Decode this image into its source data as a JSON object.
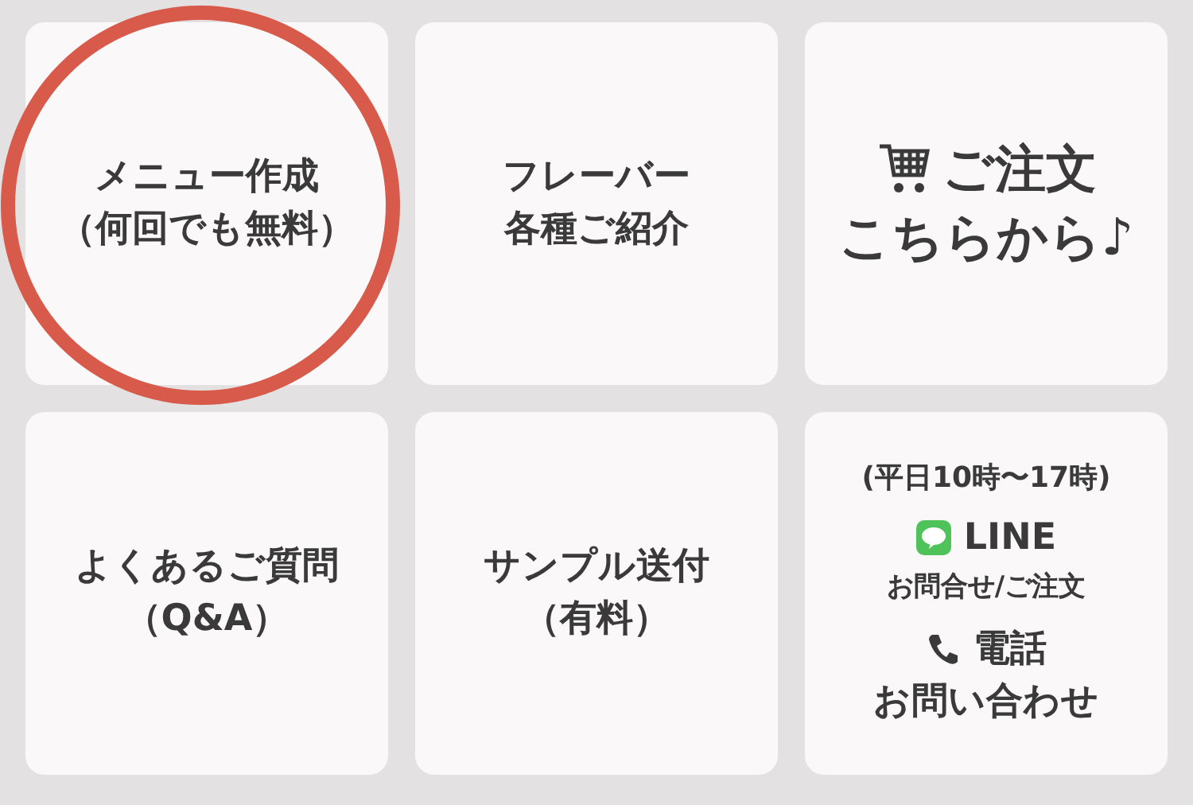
{
  "tiles": [
    {
      "kind": "link",
      "circled": true,
      "lines": [
        "メニュー作成",
        "（何回でも無料）"
      ]
    },
    {
      "kind": "link",
      "circled": false,
      "lines": [
        "フレーバー",
        "各種ご紹介"
      ]
    },
    {
      "kind": "order",
      "circled": false,
      "lines": [
        "ご注文",
        "こちらから♪"
      ]
    },
    {
      "kind": "link",
      "circled": false,
      "lines": [
        "よくあるご質問",
        "（Q&A）"
      ]
    },
    {
      "kind": "link",
      "circled": false,
      "lines": [
        "サンプル送付",
        "（有料）"
      ]
    },
    {
      "kind": "contact",
      "circled": false,
      "hours": "(平日10時〜17時)",
      "line_label": "LINE",
      "line_sub": "お問合せ/ご注文",
      "phone_label": "電話",
      "phone_sub": "お問い合わせ"
    }
  ]
}
